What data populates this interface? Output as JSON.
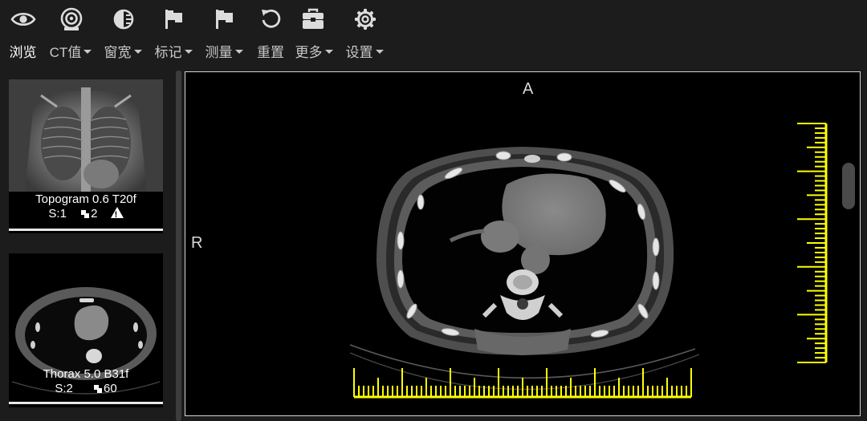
{
  "toolbar": {
    "tools": [
      {
        "id": "browse",
        "label": "浏览",
        "icon": "eye-icon",
        "dropdown": false,
        "active": true
      },
      {
        "id": "ct",
        "label": "CT值",
        "icon": "ct-scanner-icon",
        "dropdown": true
      },
      {
        "id": "window",
        "label": "窗宽",
        "icon": "contrast-icon",
        "dropdown": true
      },
      {
        "id": "mark",
        "label": "标记",
        "icon": "flag-icon",
        "dropdown": true
      },
      {
        "id": "measure",
        "label": "测量",
        "icon": "flag-icon",
        "dropdown": true
      },
      {
        "id": "reset",
        "label": "重置",
        "icon": "reset-icon",
        "dropdown": false
      },
      {
        "id": "more",
        "label": "更多",
        "icon": "toolbox-icon",
        "dropdown": true
      },
      {
        "id": "settings",
        "label": "设置",
        "icon": "gear-icon",
        "dropdown": true
      }
    ]
  },
  "series": [
    {
      "title": "Topogram 0.6 T20f",
      "s_label": "S:1",
      "count": "2",
      "warning": true,
      "thumb": "topogram"
    },
    {
      "title": "Thorax 5.0 B31f",
      "s_label": "S:2",
      "count": "60",
      "warning": false,
      "thumb": "axial"
    }
  ],
  "viewer": {
    "orientation_top": "A",
    "orientation_left": "R",
    "ruler_color": "#ffff00"
  }
}
